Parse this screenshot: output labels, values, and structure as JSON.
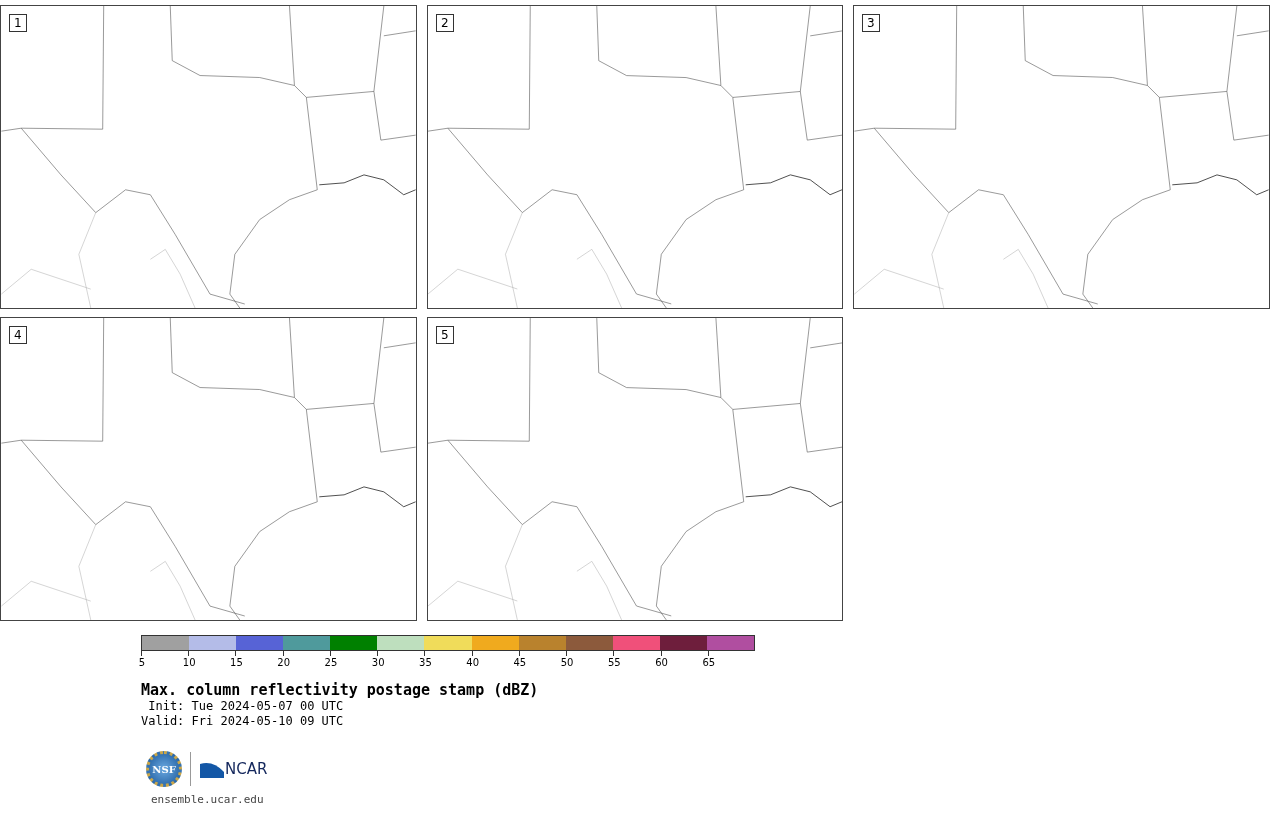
{
  "panels": [
    {
      "label": "1"
    },
    {
      "label": "2"
    },
    {
      "label": "3"
    },
    {
      "label": "4"
    },
    {
      "label": "5"
    }
  ],
  "colorbar": {
    "segments": [
      {
        "color": "#a0a0a0"
      },
      {
        "color": "#b4bce8"
      },
      {
        "color": "#5763d6"
      },
      {
        "color": "#4f9a9c"
      },
      {
        "color": "#008000"
      },
      {
        "color": "#bedfbe"
      },
      {
        "color": "#f0dc5a"
      },
      {
        "color": "#f0aa1e"
      },
      {
        "color": "#b9822d"
      },
      {
        "color": "#8c5a3c"
      },
      {
        "color": "#f0507a"
      },
      {
        "color": "#6e1e3c"
      },
      {
        "color": "#b04ea0"
      }
    ],
    "ticks": [
      "5",
      "10",
      "15",
      "20",
      "25",
      "30",
      "35",
      "40",
      "45",
      "50",
      "55",
      "60",
      "65"
    ]
  },
  "title": "Max. column reflectivity postage stamp (dBZ)",
  "init": " Init: Tue 2024-05-07 00 UTC",
  "valid": "Valid: Fri 2024-05-10 09 UTC",
  "logos": {
    "nsf": "NSF",
    "ncar": "NCAR"
  },
  "url": "ensemble.ucar.edu"
}
